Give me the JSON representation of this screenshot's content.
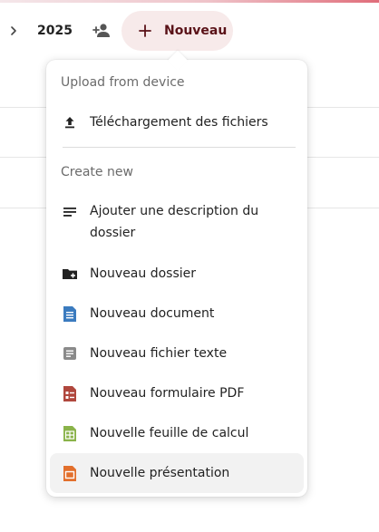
{
  "toolbar": {
    "breadcrumb_label": "2025",
    "new_button_label": "Nouveau"
  },
  "menu": {
    "upload_caption": "Upload from device",
    "upload_items": [
      {
        "label": "Téléchargement des fichiers",
        "icon": "upload-icon"
      }
    ],
    "create_caption": "Create new",
    "create_items": [
      {
        "label": "Ajouter une description du dossier",
        "icon": "description-icon"
      },
      {
        "label": "Nouveau dossier",
        "icon": "new-folder-icon"
      },
      {
        "label": "Nouveau document",
        "icon": "document-icon"
      },
      {
        "label": "Nouveau fichier texte",
        "icon": "text-file-icon"
      },
      {
        "label": "Nouveau formulaire PDF",
        "icon": "pdf-form-icon"
      },
      {
        "label": "Nouvelle feuille de calcul",
        "icon": "spreadsheet-icon"
      },
      {
        "label": "Nouvelle présentation",
        "icon": "presentation-icon"
      }
    ]
  },
  "colors": {
    "accent_bg": "#f7eaea",
    "accent_text": "#5a1218",
    "document_blue": "#3b7bbf",
    "text_file_grey": "#8a8a8a",
    "pdf_red": "#b0473d",
    "spreadsheet_green": "#8ab34a",
    "presentation_orange": "#e26f2c"
  }
}
